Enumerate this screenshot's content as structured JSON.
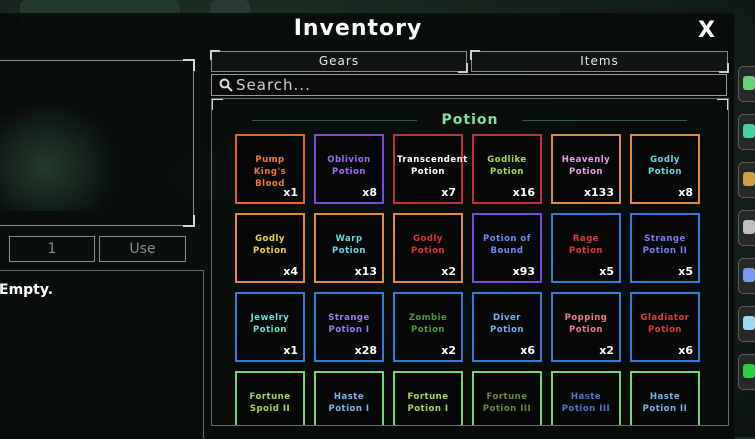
{
  "window": {
    "title": "Inventory",
    "close_label": "X"
  },
  "tabs": [
    {
      "label": "Gears"
    },
    {
      "label": "Items"
    }
  ],
  "search": {
    "placeholder": "Search..."
  },
  "section": {
    "title": "Potion",
    "color": "#7ce3a0"
  },
  "detail": {
    "quantity": "1",
    "use_label": "Use",
    "description": "Empty."
  },
  "items": [
    {
      "name": "Pump King's Blood",
      "count": "x1",
      "color": "#e8622f",
      "text_color": "#f07a3a"
    },
    {
      "name": "Oblivion Potion",
      "count": "x8",
      "color": "#7b4ad6",
      "text_color": "#9b6af0"
    },
    {
      "name": "Transcendent Potion",
      "count": "x7",
      "color": "#c0323a",
      "text_color": "#ffffff"
    },
    {
      "name": "Godlike Potion",
      "count": "x16",
      "color": "#c0323a",
      "text_color": "#a8d84a"
    },
    {
      "name": "Heavenly Potion",
      "count": "x133",
      "color": "#e08a3a",
      "text_color": "#e8a0e0"
    },
    {
      "name": "Godly Potion",
      "count": "x8",
      "color": "#e08a3a",
      "text_color": "#6ad6e0"
    },
    {
      "name": "Godly Potion",
      "count": "x4",
      "color": "#e08a3a",
      "text_color": "#f0d040"
    },
    {
      "name": "Warp Potion",
      "count": "x13",
      "color": "#e08a3a",
      "text_color": "#6ad6e0"
    },
    {
      "name": "Godly Potion",
      "count": "x2",
      "color": "#e08a3a",
      "text_color": "#e03030"
    },
    {
      "name": "Potion of Bound",
      "count": "x93",
      "color": "#7b4ad6",
      "text_color": "#6a8af0"
    },
    {
      "name": "Rage Potion",
      "count": "x5",
      "color": "#3a7ad0",
      "text_color": "#e03a3a"
    },
    {
      "name": "Strange Potion II",
      "count": "x5",
      "color": "#3a7ad0",
      "text_color": "#7a7af0"
    },
    {
      "name": "Jewelry Potion",
      "count": "x1",
      "color": "#3a7ad0",
      "text_color": "#6ae0d0"
    },
    {
      "name": "Strange Potion I",
      "count": "x28",
      "color": "#3a7ad0",
      "text_color": "#9a7af0"
    },
    {
      "name": "Zombie Potion",
      "count": "x2",
      "color": "#3a7ad0",
      "text_color": "#4a9a3a"
    },
    {
      "name": "Diver Potion",
      "count": "x6",
      "color": "#3a7ad0",
      "text_color": "#7ab0f0"
    },
    {
      "name": "Popping Potion",
      "count": "x2",
      "color": "#3a7ad0",
      "text_color": "#f07a8a"
    },
    {
      "name": "Gladiator Potion",
      "count": "x6",
      "color": "#3a7ad0",
      "text_color": "#e03a3a"
    },
    {
      "name": "Fortune Spoid II",
      "count": "",
      "color": "#7ad07a",
      "text_color": "#a8d84a"
    },
    {
      "name": "Haste Potion I",
      "count": "",
      "color": "#7ad07a",
      "text_color": "#7ab0f0"
    },
    {
      "name": "Fortune Potion I",
      "count": "",
      "color": "#7ad07a",
      "text_color": "#a8d84a"
    },
    {
      "name": "Fortune Potion III",
      "count": "",
      "color": "#7ad07a",
      "text_color": "#6a8a3a"
    },
    {
      "name": "Haste Potion III",
      "count": "",
      "color": "#7ad07a",
      "text_color": "#4a7ad0"
    },
    {
      "name": "Haste Potion II",
      "count": "",
      "color": "#7ad07a",
      "text_color": "#7ab0f0"
    }
  ],
  "side_buttons": [
    {
      "icon": "gear-green-icon",
      "color": "#6ad07a"
    },
    {
      "icon": "gem-icon",
      "color": "#4ad0a0"
    },
    {
      "icon": "scroll-icon",
      "color": "#d0a040"
    },
    {
      "icon": "cloud-icon",
      "color": "#c0c0c0"
    },
    {
      "icon": "star-icon",
      "color": "#7a9af0"
    },
    {
      "icon": "snowflake-icon",
      "color": "#a0d8f0"
    },
    {
      "icon": "green-box-icon",
      "color": "#2ad040"
    }
  ]
}
